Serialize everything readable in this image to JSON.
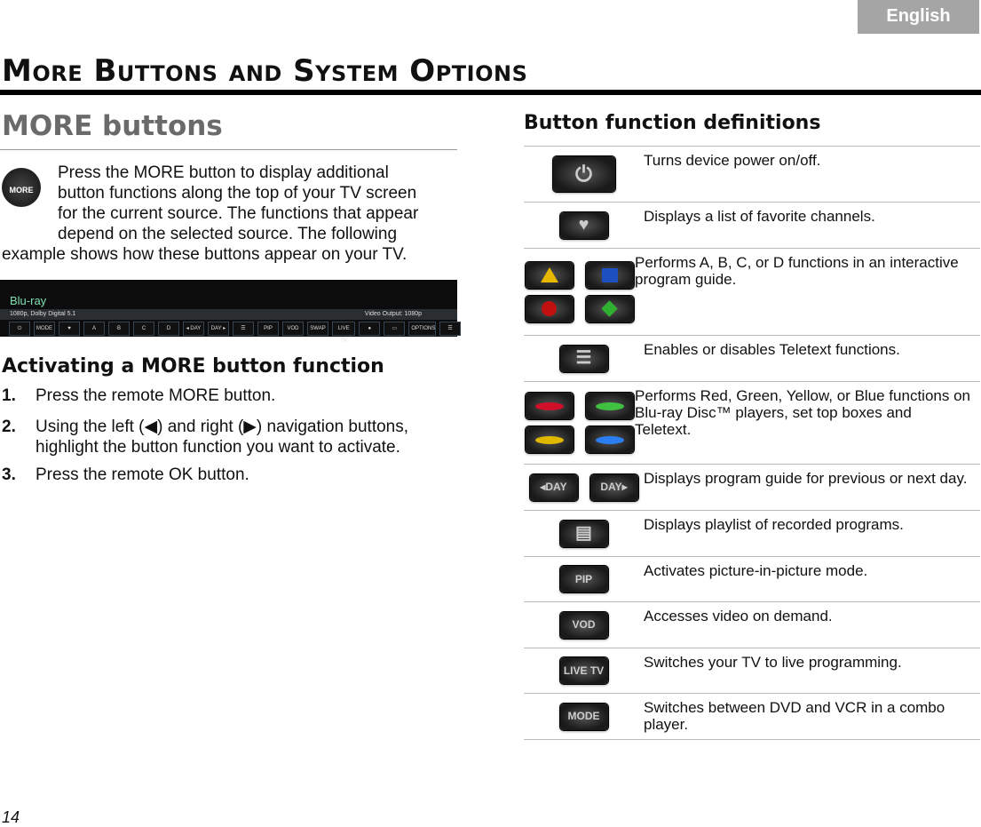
{
  "language_tab": "English",
  "page_title": "More Buttons and System Options",
  "left": {
    "heading": "MORE buttons",
    "more_icon_label": "MORE",
    "intro_lines": [
      "Press the MORE button to display additional",
      "button functions along the top of your TV screen",
      "for the current source. The functions that appear",
      "depend on the selected source. The following"
    ],
    "intro_last": "example shows how these buttons appear on your TV.",
    "banner": {
      "source": "Blu-ray",
      "info_left": "1080p, Dolby Digital 5.1",
      "info_right": "Video Output: 1080p",
      "buttons": [
        "⏻",
        "MODE",
        "♥",
        "A",
        "B",
        "C",
        "D",
        "◂ DAY",
        "DAY ▸",
        "☰",
        "PIP",
        "VOD",
        "SWAP",
        "LIVE TV",
        "●",
        "▭",
        "OPTIONS",
        "☰"
      ]
    },
    "activate_heading": "Activating a MORE button function",
    "steps": [
      {
        "num": "1.",
        "text": "Press the remote MORE button."
      },
      {
        "num": "2.",
        "text_a": "Using the left (",
        "text_b": ") and right (",
        "text_c": ") navigation buttons, highlight the button function you want to activate."
      },
      {
        "num": "3.",
        "text": "Press the remote OK button."
      }
    ]
  },
  "right": {
    "heading": "Button function definitions",
    "rows": [
      {
        "icons": [
          "power"
        ],
        "desc": "Turns device power on/off."
      },
      {
        "icons": [
          "heart"
        ],
        "desc": "Displays a list of favorite channels."
      },
      {
        "icons": [
          "A",
          "B",
          "C",
          "D"
        ],
        "desc": "Performs A, B, C, or D functions in an interactive program guide."
      },
      {
        "icons": [
          "teletext"
        ],
        "desc": "Enables or disables Teletext functions."
      },
      {
        "icons": [
          "red",
          "green",
          "yellow",
          "blue"
        ],
        "desc": "Performs Red, Green, Yellow, or Blue functions on Blu-ray Disc™ players, set top boxes and Teletext."
      },
      {
        "icons": [
          "◂DAY",
          "DAY▸"
        ],
        "desc": "Displays program guide for previous or next day."
      },
      {
        "icons": [
          "playlist"
        ],
        "desc": "Displays playlist of recorded programs."
      },
      {
        "icons": [
          "PIP"
        ],
        "desc": "Activates picture-in-picture mode."
      },
      {
        "icons": [
          "VOD"
        ],
        "desc": "Accesses video on demand."
      },
      {
        "icons": [
          "LIVE TV"
        ],
        "desc": "Switches your TV to live programming."
      },
      {
        "icons": [
          "MODE"
        ],
        "desc": "Switches between DVD and VCR in a combo player."
      }
    ]
  },
  "colors": {
    "red": "#d0102a",
    "green": "#40c040",
    "yellow": "#e0b800",
    "blue": "#2a7ef0",
    "a": "#e8b800",
    "b": "#1d4fc0",
    "c": "#c01010",
    "d": "#30b030"
  },
  "page_number": "14"
}
